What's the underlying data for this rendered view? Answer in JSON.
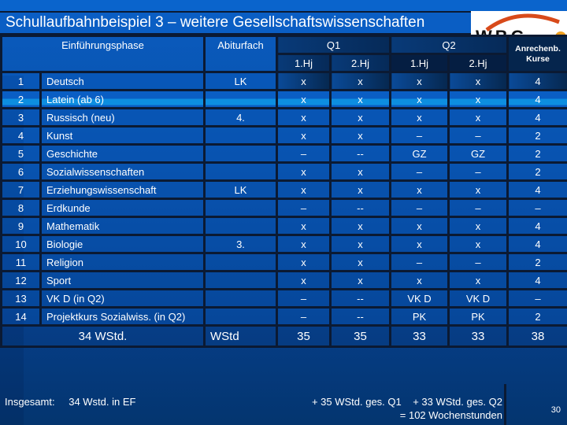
{
  "title": "Schullaufbahnbeispiel 3 – weitere Gesellschaftswissenschaften",
  "logo": {
    "text": "WBG",
    "icon": "wbg-logo-icon",
    "arc_color": "#d84a1a",
    "dot_color": "#f0a020"
  },
  "header": {
    "einfuehrungsphase": "Einführungsphase",
    "abiturfach": "Abiturfach",
    "q1": "Q1",
    "q2": "Q2",
    "anrechenb_line1": "Anrechenb.",
    "anrechenb_line2": "Kurse",
    "halfyears": [
      "1.Hj",
      "2.Hj",
      "1.Hj",
      "2.Hj"
    ]
  },
  "rows": [
    {
      "num": "1",
      "subject": "Deutsch",
      "abi": "LK",
      "q1h1": "x",
      "q1h2": "x",
      "q2h1": "x",
      "q2h2": "x",
      "kurse": "4"
    },
    {
      "num": "2",
      "subject": "Latein (ab 6)",
      "abi": "",
      "q1h1": "x",
      "q1h2": "x",
      "q2h1": "x",
      "q2h2": "x",
      "kurse": "4"
    },
    {
      "num": "3",
      "subject": "Russisch (neu)",
      "abi": "4.",
      "q1h1": "x",
      "q1h2": "x",
      "q2h1": "x",
      "q2h2": "x",
      "kurse": "4"
    },
    {
      "num": "4",
      "subject": "Kunst",
      "abi": "",
      "q1h1": "x",
      "q1h2": "x",
      "q2h1": "–",
      "q2h2": "–",
      "kurse": "2"
    },
    {
      "num": "5",
      "subject": "Geschichte",
      "abi": "",
      "q1h1": "–",
      "q1h2": "--",
      "q2h1": "GZ",
      "q2h2": "GZ",
      "kurse": "2"
    },
    {
      "num": "6",
      "subject": "Sozialwissenschaften",
      "abi": "",
      "q1h1": "x",
      "q1h2": "x",
      "q2h1": "–",
      "q2h2": "–",
      "kurse": "2"
    },
    {
      "num": "7",
      "subject": "Erziehungswissenschaft",
      "abi": "LK",
      "q1h1": "x",
      "q1h2": "x",
      "q2h1": "x",
      "q2h2": "x",
      "kurse": "4"
    },
    {
      "num": "8",
      "subject": "Erdkunde",
      "abi": "",
      "q1h1": "–",
      "q1h2": "--",
      "q2h1": "–",
      "q2h2": "–",
      "kurse": "–"
    },
    {
      "num": "9",
      "subject": "Mathematik",
      "abi": "",
      "q1h1": "x",
      "q1h2": "x",
      "q2h1": "x",
      "q2h2": "x",
      "kurse": "4"
    },
    {
      "num": "10",
      "subject": "Biologie",
      "abi": "3.",
      "q1h1": "x",
      "q1h2": "x",
      "q2h1": "x",
      "q2h2": "x",
      "kurse": "4"
    },
    {
      "num": "11",
      "subject": "Religion",
      "abi": "",
      "q1h1": "x",
      "q1h2": "x",
      "q2h1": "–",
      "q2h2": "–",
      "kurse": "2"
    },
    {
      "num": "12",
      "subject": "Sport",
      "abi": "",
      "q1h1": "x",
      "q1h2": "x",
      "q2h1": "x",
      "q2h2": "x",
      "kurse": "4"
    },
    {
      "num": "13",
      "subject": "VK D (in Q2)",
      "abi": "",
      "q1h1": "–",
      "q1h2": "--",
      "q2h1": "VK D",
      "q2h2": "VK D",
      "kurse": "–"
    },
    {
      "num": "14",
      "subject": "Projektkurs Sozialwiss. (in Q2)",
      "abi": "",
      "q1h1": "–",
      "q1h2": "--",
      "q2h1": "PK",
      "q2h2": "PK",
      "kurse": "2"
    }
  ],
  "totals": {
    "ef": "34 WStd.",
    "abi": "WStd",
    "q1h1": "35",
    "q1h2": "35",
    "q2h1": "33",
    "q2h2": "33",
    "kurse": "38"
  },
  "footer": {
    "insgesamt_label": "Insgesamt:",
    "ef_total": "34 Wstd. in EF",
    "q_line1": "+ 35 WStd. ges. Q1    + 33 WStd. ges. Q2",
    "q_line2": "= 102 Wochenstunden",
    "page_number": "30"
  }
}
